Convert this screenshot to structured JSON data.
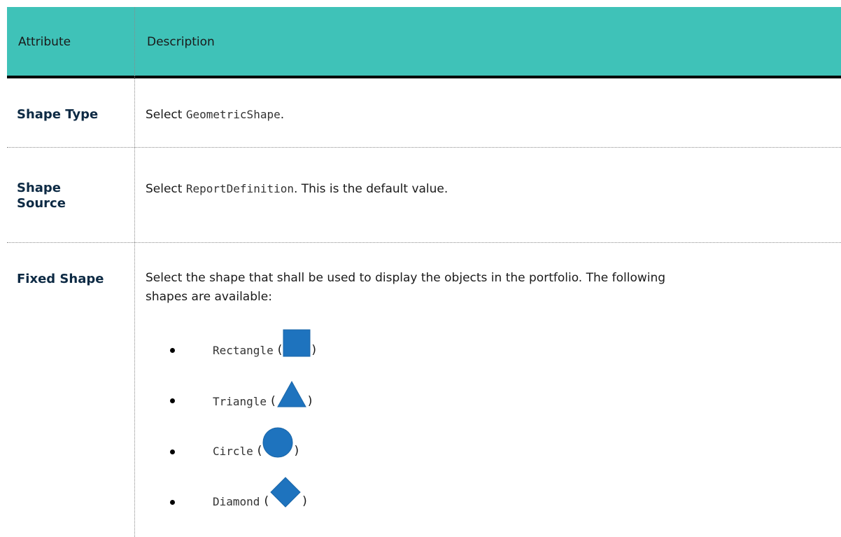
{
  "header": {
    "attribute_label": "Attribute",
    "description_label": "Description",
    "color": "#3fc2b8"
  },
  "rows": [
    {
      "attribute": "Shape Type",
      "desc_prefix": "Select ",
      "desc_code": "GeometricShape",
      "desc_suffix": "."
    },
    {
      "attribute_line1": "Shape",
      "attribute_line2": "Source",
      "desc_prefix": "Select ",
      "desc_code": "ReportDefinition",
      "desc_suffix": ". This is the default value."
    },
    {
      "attribute": "Fixed Shape",
      "desc_line1": "Select the shape that shall be used to display the objects in the portfolio. The following",
      "desc_line2": "shapes are available:",
      "shapes": [
        {
          "name": "Rectangle",
          "icon": "square-icon"
        },
        {
          "name": "Triangle",
          "icon": "triangle-icon"
        },
        {
          "name": "Circle",
          "icon": "circle-icon"
        },
        {
          "name": "Diamond",
          "icon": "diamond-icon"
        }
      ]
    }
  ],
  "icon_color": "#1e73be",
  "paren_open": "(",
  "paren_close": ")"
}
